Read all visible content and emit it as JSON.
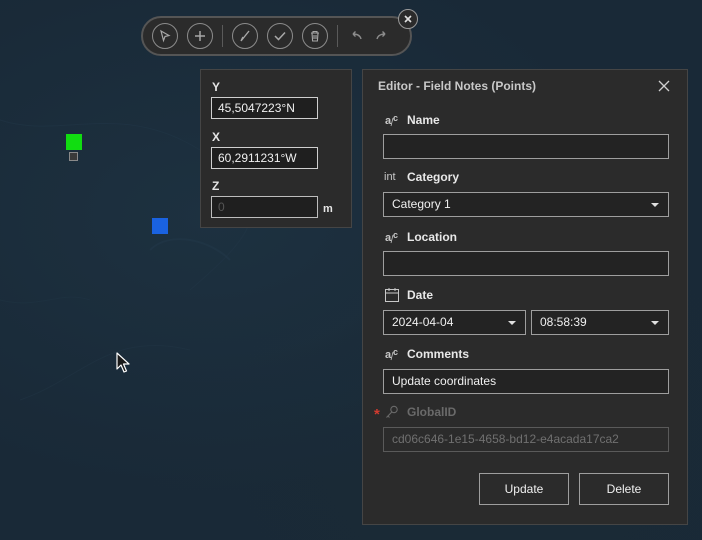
{
  "toolbar": {
    "tools": [
      "select-tool-icon",
      "add-point-icon",
      "reshape-icon",
      "confirm-icon",
      "delete-icon"
    ],
    "history": [
      "undo-icon",
      "redo-icon"
    ]
  },
  "coordinates": {
    "y_label": "Y",
    "y_value": "45,5047223°N",
    "x_label": "X",
    "x_value": "60,2911231°W",
    "z_label": "Z",
    "z_value": "0",
    "z_unit": "m"
  },
  "editor": {
    "title": "Editor - Field Notes (Points)",
    "fields": {
      "name": {
        "label": "Name",
        "value": ""
      },
      "category": {
        "type_label": "int",
        "label": "Category",
        "value": "Category 1"
      },
      "location": {
        "label": "Location",
        "value": ""
      },
      "date": {
        "label": "Date",
        "date_value": "2024-04-04",
        "time_value": "08:58:39"
      },
      "comments": {
        "label": "Comments",
        "value": "Update coordinates"
      },
      "globalid": {
        "label": "GlobalID",
        "value": "cd06c646-1e15-4658-bd12-e4acada17ca2",
        "required_mark": "*"
      }
    },
    "buttons": {
      "update": "Update",
      "delete": "Delete"
    }
  },
  "colors": {
    "map_background": "#192937",
    "panel_background": "#2b2b2b",
    "marker_green": "#11dd11",
    "marker_blue": "#1a62e0",
    "required_red": "#d23b2f"
  }
}
